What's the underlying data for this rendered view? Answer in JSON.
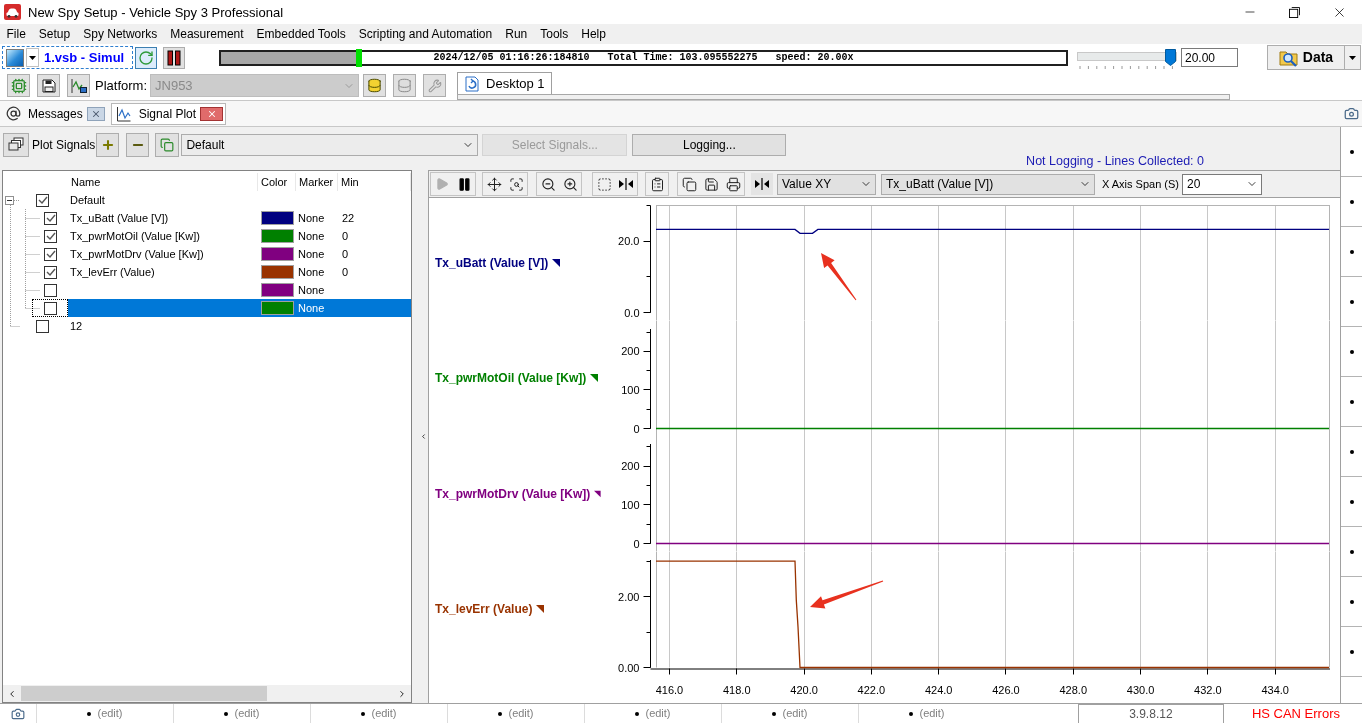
{
  "window": {
    "title": "New Spy Setup - Vehicle Spy 3 Professional"
  },
  "menu": [
    "File",
    "Setup",
    "Spy Networks",
    "Measurement",
    "Embedded Tools",
    "Scripting and Automation",
    "Run",
    "Tools",
    "Help"
  ],
  "toolbar": {
    "setup_file": "1.vsb - Simul",
    "playback": {
      "level": 0.163,
      "texts": [
        "2024/12/05 01:16:26:184810",
        "Total Time: 103.095552275",
        "speed: 20.00x"
      ]
    },
    "speed_slider": {
      "level": 1
    },
    "speed_value": "20.00",
    "data_button": "Data"
  },
  "platform_bar": {
    "label": "Platform:",
    "platform": {
      "value": "JN953",
      "disabled": true
    },
    "tabs": [
      {
        "label": "Desktop 1",
        "selected": true
      }
    ]
  },
  "view_tabs": [
    {
      "kind": "messages",
      "label": "Messages",
      "selected": false
    },
    {
      "kind": "signal_plot",
      "label": "Signal Plot",
      "selected": true
    }
  ],
  "plot_signals_bar": {
    "plot_signals": "Plot Signals",
    "group": "Default",
    "buttons": [
      {
        "label": "Select Signals...",
        "disabled": true
      },
      {
        "label": "Logging...",
        "disabled": false
      }
    ],
    "logging_status": "Not Logging - Lines Collected: 0"
  },
  "signal_tree": {
    "columns": [
      "Name",
      "Color",
      "Marker",
      "Min"
    ],
    "items": [
      {
        "name": "Default",
        "checked": true,
        "expanded": true,
        "selected": false,
        "children": [
          {
            "name": "Tx_uBatt (Value [V])",
            "checked": true,
            "selected": false,
            "color": "#000080",
            "marker": "None",
            "min": "22"
          },
          {
            "name": "Tx_pwrMotOil (Value [Kw])",
            "checked": true,
            "selected": false,
            "color": "#008000",
            "marker": "None",
            "min": "0"
          },
          {
            "name": "Tx_pwrMotDrv (Value [Kw])",
            "checked": true,
            "selected": false,
            "color": "#800080",
            "marker": "None",
            "min": "0"
          },
          {
            "name": "Tx_levErr (Value)",
            "checked": true,
            "selected": false,
            "color": "#993300",
            "marker": "None",
            "min": "0"
          },
          {
            "checked": false,
            "selected": false,
            "color": "#800080",
            "marker": "None"
          },
          {
            "checked": false,
            "selected": true,
            "color": "#008000",
            "marker": "None"
          }
        ]
      },
      {
        "name": "12",
        "checked": false,
        "selected": false
      }
    ]
  },
  "plot": {
    "toolbar": {
      "mode": "Value XY",
      "signal": "Tx_uBatt (Value [V])",
      "span_label": "X Axis Span (S)",
      "span": "20"
    },
    "chart_data": [
      {
        "type": "line",
        "ylabel": "Tx_uBatt (Value [V])",
        "color": "#000080",
        "x": [
          415.6,
          419.73,
          419.88,
          420.25,
          420.41,
          435.6
        ],
        "values": [
          23.3,
          23.3,
          22.2,
          22.2,
          23.3,
          23.3
        ],
        "xlim": [
          415.6,
          435.6
        ],
        "ylim": [
          0,
          30
        ],
        "xticks": [
          416,
          418,
          420,
          422,
          424,
          426,
          428,
          430,
          432,
          434
        ],
        "yticks": [
          {
            "value": 0,
            "label": "0.0"
          },
          {
            "value": 20,
            "label": "20.0"
          }
        ],
        "tick_labels": "y",
        "grid": "x"
      },
      {
        "type": "line",
        "ylabel": "Tx_pwrMotOil (Value [Kw])",
        "color": "#008000",
        "x": [
          415.6,
          435.6
        ],
        "values": [
          0,
          0
        ],
        "xlim": [
          415.6,
          435.6
        ],
        "ylim": [
          0,
          258
        ],
        "xticks": [
          416,
          418,
          420,
          422,
          424,
          426,
          428,
          430,
          432,
          434
        ],
        "yticks": [
          0,
          100,
          200
        ],
        "tick_labels": "y",
        "grid": "x"
      },
      {
        "type": "line",
        "ylabel": "Tx_pwrMotDrv (Value [Kw])",
        "color": "#800080",
        "x": [
          415.6,
          435.6
        ],
        "values": [
          0,
          0
        ],
        "xlim": [
          415.6,
          435.6
        ],
        "ylim": [
          0,
          257
        ],
        "xticks": [
          416,
          418,
          420,
          422,
          424,
          426,
          428,
          430,
          432,
          434
        ],
        "yticks": [
          0,
          100,
          200
        ],
        "tick_labels": "y",
        "grid": "x"
      },
      {
        "type": "line",
        "ylabel": "Tx_levErr (Value)",
        "color": "#993300",
        "x": [
          415.6,
          419.73,
          419.77,
          419.82,
          419.88,
          435.6
        ],
        "values": [
          3,
          3,
          1.9,
          1.15,
          0,
          0
        ],
        "xlim": [
          415.6,
          435.6
        ],
        "ylim": [
          0,
          3.03
        ],
        "xticks": [
          {
            "value": 416,
            "label": "416.0"
          },
          {
            "value": 418,
            "label": "418.0"
          },
          {
            "value": 420,
            "label": "420.0"
          },
          {
            "value": 422,
            "label": "422.0"
          },
          {
            "value": 424,
            "label": "424.0"
          },
          {
            "value": 426,
            "label": "426.0"
          },
          {
            "value": 428,
            "label": "428.0"
          },
          {
            "value": 430,
            "label": "430.0"
          },
          {
            "value": 432,
            "label": "432.0"
          },
          {
            "value": 434,
            "label": "434.0"
          }
        ],
        "yticks": [
          {
            "value": 0,
            "label": "0.00"
          },
          {
            "value": 2,
            "label": "2.00"
          }
        ],
        "grid": "x"
      }
    ]
  },
  "status_bar": {
    "cells": [
      "(edit)",
      "(edit)",
      "(edit)",
      "(edit)",
      "(edit)",
      "(edit)",
      "(edit)"
    ],
    "version": "3.9.8.12",
    "errors": "HS CAN Errors"
  }
}
